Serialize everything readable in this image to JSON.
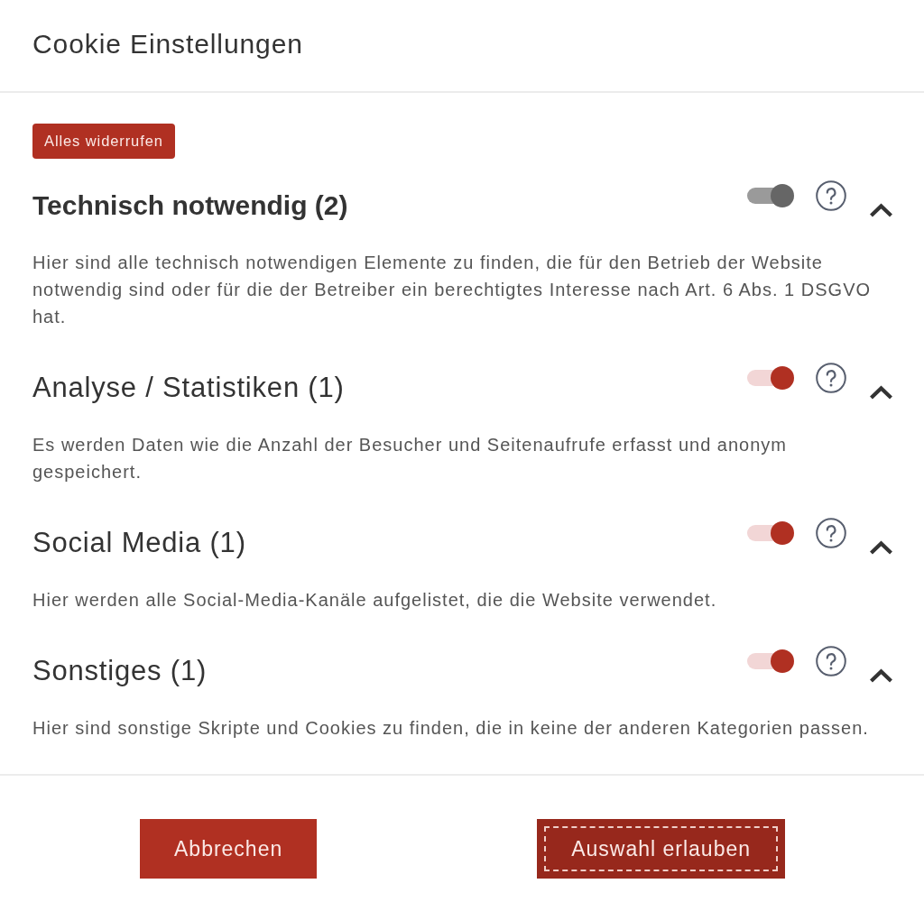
{
  "dialog": {
    "title": "Cookie Einstellungen"
  },
  "revoke_button": {
    "label": "Alles widerrufen"
  },
  "categories": [
    {
      "title": "Technisch notwendig (2)",
      "kind": "required",
      "on": true,
      "disabled": true,
      "expanded": true,
      "description": "Hier sind alle technisch notwendigen Elemente zu finden, die für den Betrieb der Website notwendig sind oder für die der Betreiber ein berechtigtes Interesse nach Art. 6 Abs. 1 DSGVO hat."
    },
    {
      "title": "Analyse / Statistiken (1)",
      "kind": "optional",
      "on": true,
      "disabled": false,
      "expanded": true,
      "description": "Es werden Daten wie die Anzahl der Besucher und Seitenaufrufe erfasst und anonym gespeichert."
    },
    {
      "title": "Social Media (1)",
      "kind": "optional",
      "on": true,
      "disabled": false,
      "expanded": true,
      "description": "Hier werden alle Social-Media-Kanäle aufgelistet, die die Website verwendet."
    },
    {
      "title": "Sonstiges (1)",
      "kind": "optional",
      "on": true,
      "disabled": false,
      "expanded": true,
      "description": "Hier sind sonstige Skripte und Cookies zu finden, die in keine der anderen Kategorien passen."
    }
  ],
  "footer_buttons": [
    {
      "label": "Abbrechen",
      "focused": false
    },
    {
      "label": "Auswahl erlauben",
      "focused": true
    }
  ]
}
